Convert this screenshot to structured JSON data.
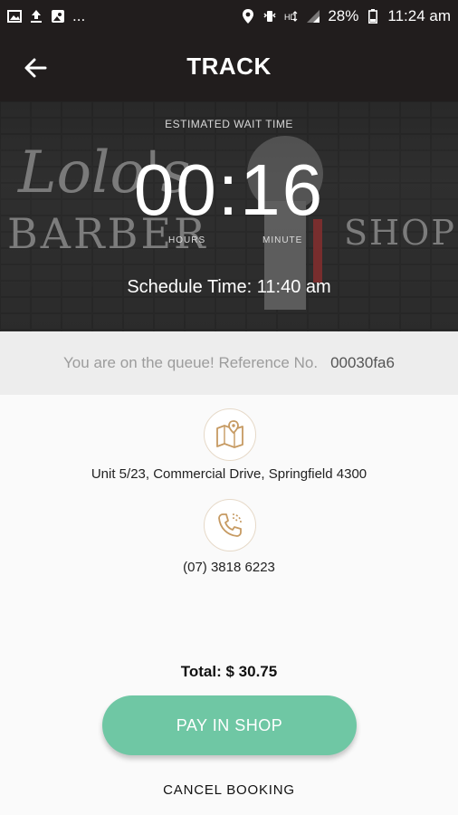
{
  "status_bar": {
    "left_icons": [
      "image-icon",
      "upload-icon",
      "gallery-icon"
    ],
    "more": "...",
    "right_icons": [
      "location-icon",
      "vibrate-icon",
      "hd-icon",
      "signal-icon"
    ],
    "battery": "28%",
    "time": "11:24 am"
  },
  "app_bar": {
    "title": "TRACK"
  },
  "hero": {
    "caption": "ESTIMATED WAIT TIME",
    "timer": "00:16",
    "hours_label": "HOURS",
    "minute_label": "MINUTE",
    "schedule": "Schedule Time: 11:40 am"
  },
  "queue": {
    "label": "You are on the queue! Reference No.",
    "reference": "00030fa6"
  },
  "location": {
    "address": "Unit 5/23, Commercial Drive, Springfield 4300"
  },
  "contact": {
    "phone": "(07) 3818 6223"
  },
  "footer": {
    "total": "Total: $ 30.75",
    "pay_button": "PAY IN SHOP",
    "cancel_button": "CANCEL BOOKING"
  },
  "colors": {
    "dark": "#211d1d",
    "accent": "#6fc7a4",
    "icon_gold": "#c69a62"
  }
}
